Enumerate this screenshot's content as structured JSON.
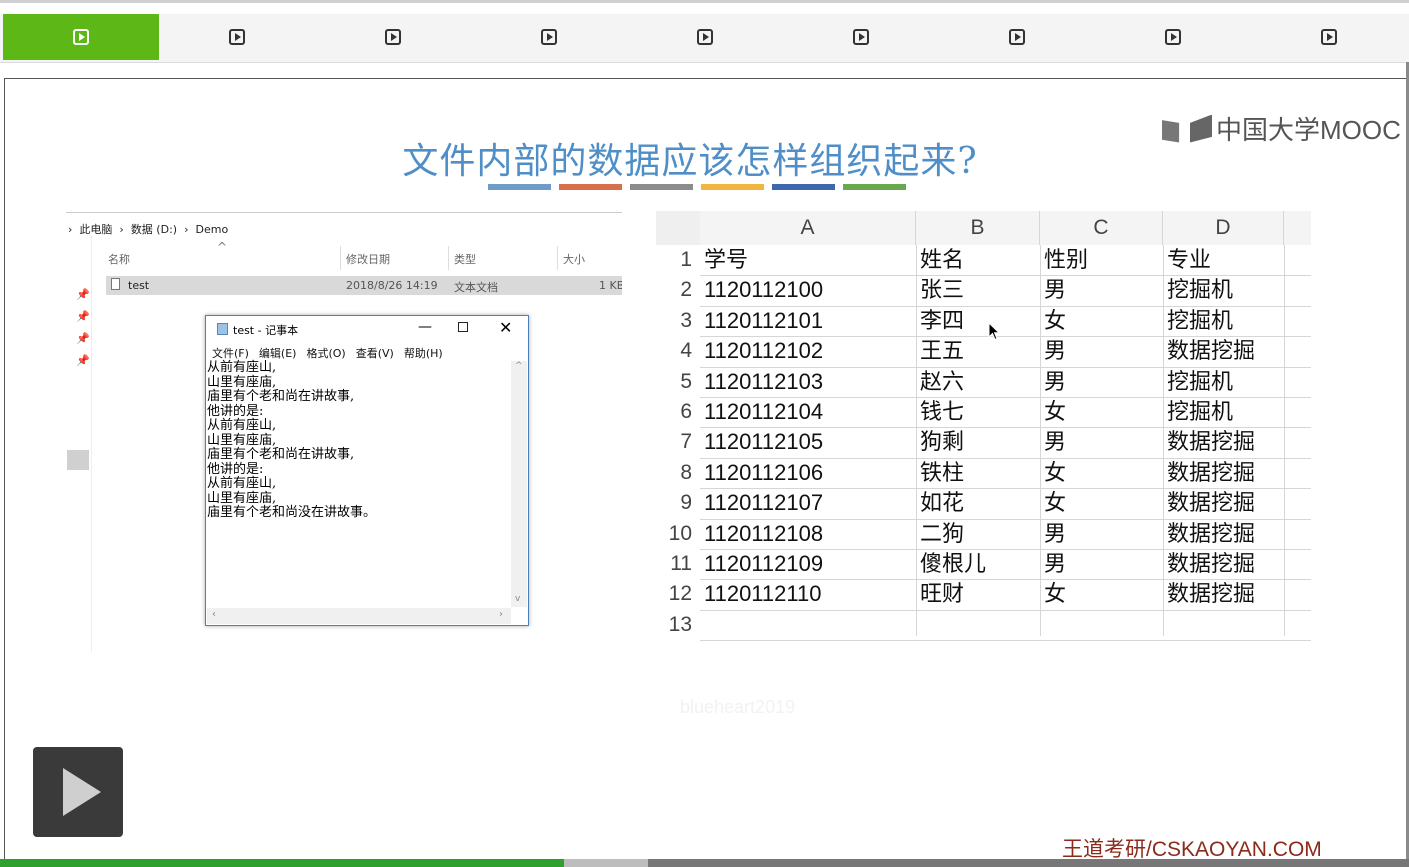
{
  "tabs": [
    "",
    "",
    "",
    "",
    "",
    "",
    "",
    "",
    ""
  ],
  "slide": {
    "title": "文件内部的数据应该怎样组织起来?",
    "logo_text": "中国大学MOOC",
    "bar_colors": [
      "#6f9bc8",
      "#d86f4a",
      "#8c8c8c",
      "#f2b640",
      "#3d68ad",
      "#6aa84f"
    ],
    "watermark": "blueheart2019",
    "brand": "王道考研/CSKAOYAN.COM"
  },
  "explorer": {
    "breadcrumb": [
      "此电脑",
      "数据 (D:)",
      "Demo"
    ],
    "columns": [
      "名称",
      "修改日期",
      "类型",
      "大小"
    ],
    "file": {
      "name": "test",
      "date": "2018/8/26 14:19",
      "type": "文本文档",
      "size": "1 KB"
    }
  },
  "notepad": {
    "title": "test - 记事本",
    "menu": [
      "文件(F)",
      "编辑(E)",
      "格式(O)",
      "查看(V)",
      "帮助(H)"
    ],
    "lines": [
      "从前有座山,",
      "山里有座庙,",
      "庙里有个老和尚在讲故事,",
      "他讲的是:",
      "从前有座山,",
      "山里有座庙,",
      "庙里有个老和尚在讲故事,",
      "他讲的是:",
      "从前有座山,",
      "山里有座庙,",
      "庙里有个老和尚没在讲故事。"
    ]
  },
  "sheet": {
    "columns": [
      "A",
      "B",
      "C",
      "D"
    ],
    "rows": [
      [
        "学号",
        "姓名",
        "性别",
        "专业"
      ],
      [
        "1120112100",
        "张三",
        "男",
        "挖掘机"
      ],
      [
        "1120112101",
        "李四",
        "女",
        "挖掘机"
      ],
      [
        "1120112102",
        "王五",
        "男",
        "数据挖掘"
      ],
      [
        "1120112103",
        "赵六",
        "男",
        "挖掘机"
      ],
      [
        "1120112104",
        "钱七",
        "女",
        "挖掘机"
      ],
      [
        "1120112105",
        "狗剩",
        "男",
        "数据挖掘"
      ],
      [
        "1120112106",
        "铁柱",
        "女",
        "数据挖掘"
      ],
      [
        "1120112107",
        "如花",
        "女",
        "数据挖掘"
      ],
      [
        "1120112108",
        "二狗",
        "男",
        "数据挖掘"
      ],
      [
        "1120112109",
        "傻根儿",
        "男",
        "数据挖掘"
      ],
      [
        "1120112110",
        "旺财",
        "女",
        "数据挖掘"
      ],
      [
        "",
        "",
        "",
        ""
      ]
    ]
  },
  "player": {
    "progress": 0.4
  }
}
